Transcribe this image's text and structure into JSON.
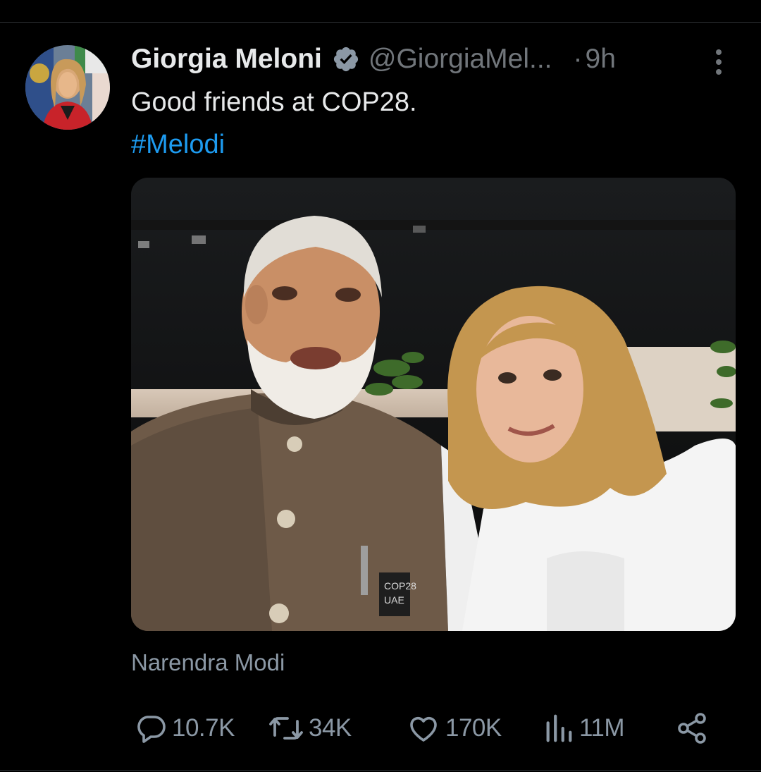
{
  "tweet": {
    "author_name": "Giorgia Meloni",
    "handle": "@GiorgiaMel...",
    "separator": "·",
    "time": "9h",
    "text": "Good friends at COP28.",
    "hashtag": "#Melodi",
    "photo_tag": "Narendra Modi",
    "badge_text": "COP28 UAE"
  },
  "actions": {
    "replies": "10.7K",
    "reposts": "34K",
    "likes": "170K",
    "views": "11M"
  },
  "icons": {
    "verified": "verified-badge-icon",
    "more": "more-vertical-icon",
    "reply": "reply-icon",
    "repost": "repost-icon",
    "like": "heart-icon",
    "views": "views-chart-icon",
    "share": "share-icon"
  },
  "colors": {
    "background": "#000000",
    "primary_text": "#e7e9ea",
    "secondary_text": "#71767b",
    "link": "#1d9bf0",
    "verified_badge": "#8b98a5"
  }
}
